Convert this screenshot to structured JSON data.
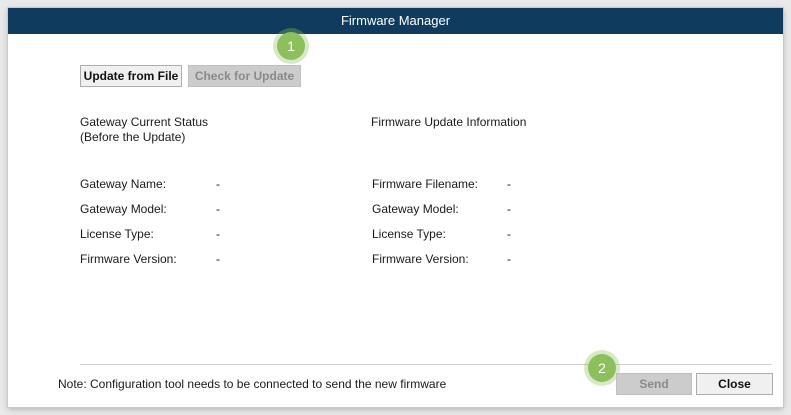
{
  "window": {
    "title": "Firmware Manager"
  },
  "toolbar": {
    "update_from_file_label": "Update from File",
    "check_for_update_label": "Check for Update"
  },
  "current_status": {
    "title_line1": "Gateway Current Status",
    "title_line2": "(Before the Update)",
    "fields": [
      {
        "label": "Gateway Name:",
        "value": "-"
      },
      {
        "label": "Gateway Model:",
        "value": "-"
      },
      {
        "label": "License Type:",
        "value": "-"
      },
      {
        "label": "Firmware Version:",
        "value": "-"
      }
    ]
  },
  "update_info": {
    "title": "Firmware Update Information",
    "fields": [
      {
        "label": "Firmware Filename:",
        "value": "-"
      },
      {
        "label": "Gateway Model:",
        "value": "-"
      },
      {
        "label": "License Type:",
        "value": "-"
      },
      {
        "label": "Firmware Version:",
        "value": "-"
      }
    ]
  },
  "footer": {
    "note": "Note: Configuration tool needs to be connected to send the new firmware",
    "send_label": "Send",
    "close_label": "Close"
  },
  "callouts": {
    "one": "1",
    "two": "2"
  },
  "colors": {
    "titlebar": "#0e3b5e",
    "callout": "#8cc05b",
    "disabled_button": "#cccccc"
  }
}
